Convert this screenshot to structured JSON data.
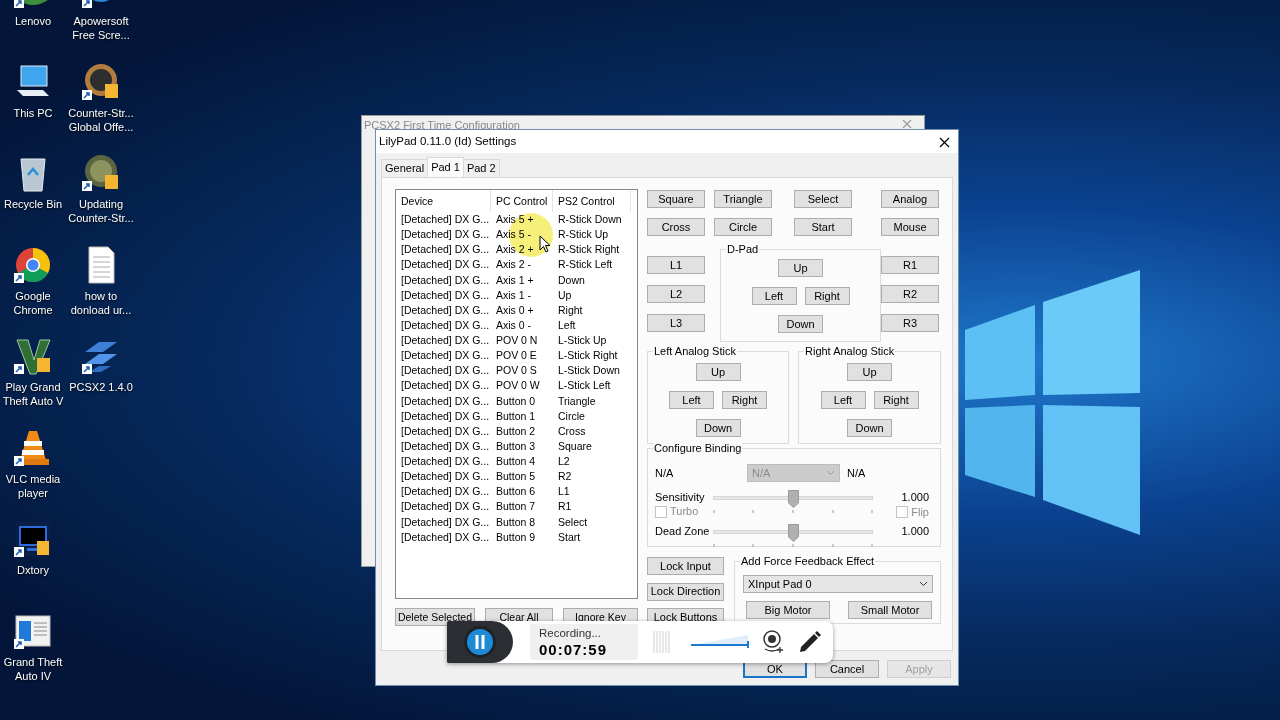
{
  "desktop": {
    "icons": [
      {
        "label": "Lenovo",
        "kind": "leaf",
        "shortcut": true
      },
      {
        "label": "This PC",
        "kind": "pc",
        "shortcut": false
      },
      {
        "label": "Recycle Bin",
        "kind": "bin",
        "shortcut": false
      },
      {
        "label": "Google Chrome",
        "kind": "wheel",
        "shortcut": true
      },
      {
        "label": "Play Grand Theft Auto V",
        "kind": "chevron",
        "shortcut": true
      },
      {
        "label": "VLC media player",
        "kind": "cone",
        "shortcut": true
      },
      {
        "label": "Dxtory",
        "kind": "screen",
        "shortcut": true
      },
      {
        "label": "Grand Theft Auto IV",
        "kind": "window",
        "shortcut": true
      },
      {
        "label": "Apowersoft Free Scre...",
        "kind": "swirl",
        "shortcut": true
      },
      {
        "label": "Counter-Str... Global Offe...",
        "kind": "badge",
        "shortcut": true
      },
      {
        "label": "Updating Counter-Str...",
        "kind": "badge2",
        "shortcut": true
      },
      {
        "label": "how to donload ur...",
        "kind": "doc",
        "shortcut": false
      },
      {
        "label": "PCSX2 1.4.0",
        "kind": "stripes",
        "shortcut": true
      }
    ]
  },
  "background_window": {
    "title": "PCSX2 First Time Configuration"
  },
  "dialog": {
    "title": "LilyPad 0.11.0 (Id) Settings",
    "tabs": [
      {
        "label": "General",
        "selected": false
      },
      {
        "label": "Pad 1",
        "selected": true
      },
      {
        "label": "Pad 2",
        "selected": false
      }
    ],
    "bindings": {
      "columns": [
        "Device",
        "PC Control",
        "PS2 Control"
      ],
      "rows": [
        [
          "[Detached] DX G...",
          "Axis 5 +",
          "R-Stick Down"
        ],
        [
          "[Detached] DX G...",
          "Axis 5 -",
          "R-Stick Up"
        ],
        [
          "[Detached] DX G...",
          "Axis 2 +",
          "R-Stick Right"
        ],
        [
          "[Detached] DX G...",
          "Axis 2 -",
          "R-Stick Left"
        ],
        [
          "[Detached] DX G...",
          "Axis 1 +",
          "Down"
        ],
        [
          "[Detached] DX G...",
          "Axis 1 -",
          "Up"
        ],
        [
          "[Detached] DX G...",
          "Axis 0 +",
          "Right"
        ],
        [
          "[Detached] DX G...",
          "Axis 0 -",
          "Left"
        ],
        [
          "[Detached] DX G...",
          "POV 0 N",
          "L-Stick Up"
        ],
        [
          "[Detached] DX G...",
          "POV 0 E",
          "L-Stick Right"
        ],
        [
          "[Detached] DX G...",
          "POV 0 S",
          "L-Stick Down"
        ],
        [
          "[Detached] DX G...",
          "POV 0 W",
          "L-Stick Left"
        ],
        [
          "[Detached] DX G...",
          "Button 0",
          "Triangle"
        ],
        [
          "[Detached] DX G...",
          "Button 1",
          "Circle"
        ],
        [
          "[Detached] DX G...",
          "Button 2",
          "Cross"
        ],
        [
          "[Detached] DX G...",
          "Button 3",
          "Square"
        ],
        [
          "[Detached] DX G...",
          "Button 4",
          "L2"
        ],
        [
          "[Detached] DX G...",
          "Button 5",
          "R2"
        ],
        [
          "[Detached] DX G...",
          "Button 6",
          "L1"
        ],
        [
          "[Detached] DX G...",
          "Button 7",
          "R1"
        ],
        [
          "[Detached] DX G...",
          "Button 8",
          "Select"
        ],
        [
          "[Detached] DX G...",
          "Button 9",
          "Start"
        ]
      ]
    },
    "list_buttons": [
      "Delete Selected",
      "Clear All",
      "Ignore Key"
    ],
    "face_buttons": [
      [
        "Square",
        "Triangle",
        "Select",
        "Analog"
      ],
      [
        "Cross",
        "Circle",
        "Start",
        "Mouse"
      ]
    ],
    "left_shoulder": [
      "L1",
      "L2",
      "L3"
    ],
    "right_shoulder": [
      "R1",
      "R2",
      "R3"
    ],
    "dpad": {
      "title": "D-Pad",
      "up": "Up",
      "left": "Left",
      "right": "Right",
      "down": "Down"
    },
    "left_stick": {
      "title": "Left Analog Stick",
      "up": "Up",
      "left": "Left",
      "right": "Right",
      "down": "Down"
    },
    "right_stick": {
      "title": "Right Analog Stick",
      "up": "Up",
      "left": "Left",
      "right": "Right",
      "down": "Down"
    },
    "configure_binding": {
      "title": "Configure Binding",
      "label_left": "N/A",
      "select": {
        "value": "N/A",
        "disabled": true
      },
      "label_right": "N/A",
      "sensitivity": {
        "label": "Sensitivity",
        "reading": "1.000",
        "level": 0.5
      },
      "turbo": {
        "label": "Turbo",
        "checked": false,
        "disabled": true
      },
      "flip": {
        "label": "Flip",
        "checked": false,
        "disabled": true
      },
      "dead_zone": {
        "label": "Dead Zone",
        "reading": "1.000",
        "level": 0.5
      }
    },
    "lock_buttons": [
      "Lock Input",
      "Lock Direction",
      "Lock Buttons"
    ],
    "force_feedback": {
      "title": "Add Force Feedback Effect",
      "select": "XInput Pad 0",
      "buttons": [
        "Big Motor",
        "Small Motor"
      ]
    },
    "footer": [
      {
        "label": "OK",
        "default": true,
        "disabled": false
      },
      {
        "label": "Cancel",
        "default": false,
        "disabled": false
      },
      {
        "label": "Apply",
        "default": false,
        "disabled": true
      }
    ]
  },
  "recorder": {
    "status": "Recording...",
    "time": "00:07:59"
  }
}
